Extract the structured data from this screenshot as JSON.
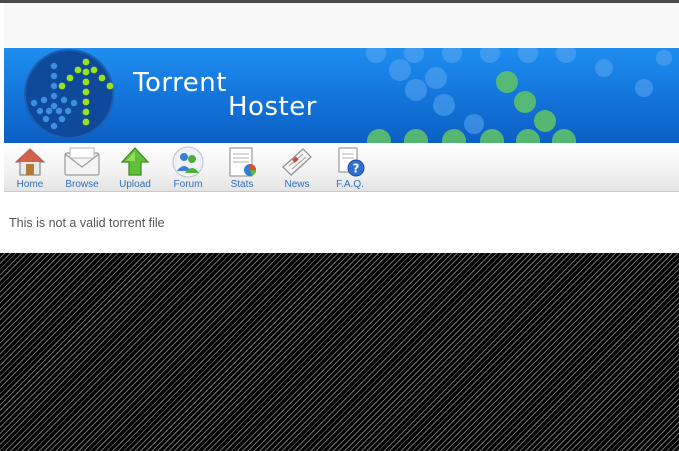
{
  "banner": {
    "title_line1": "Torrent",
    "title_line2": "Hoster"
  },
  "nav": {
    "items": [
      {
        "label": "Home",
        "icon": "house-icon"
      },
      {
        "label": "Browse",
        "icon": "envelope-icon"
      },
      {
        "label": "Upload",
        "icon": "upload-arrow-icon"
      },
      {
        "label": "Forum",
        "icon": "users-icon"
      },
      {
        "label": "Stats",
        "icon": "chart-icon"
      },
      {
        "label": "News",
        "icon": "newspaper-icon"
      },
      {
        "label": "F.A.Q.",
        "icon": "help-icon"
      }
    ]
  },
  "content": {
    "message": "This is not a valid torrent file"
  },
  "colors": {
    "banner_blue": "#1478de",
    "nav_label": "#2f6fb8",
    "logo_green": "#9be21e"
  }
}
